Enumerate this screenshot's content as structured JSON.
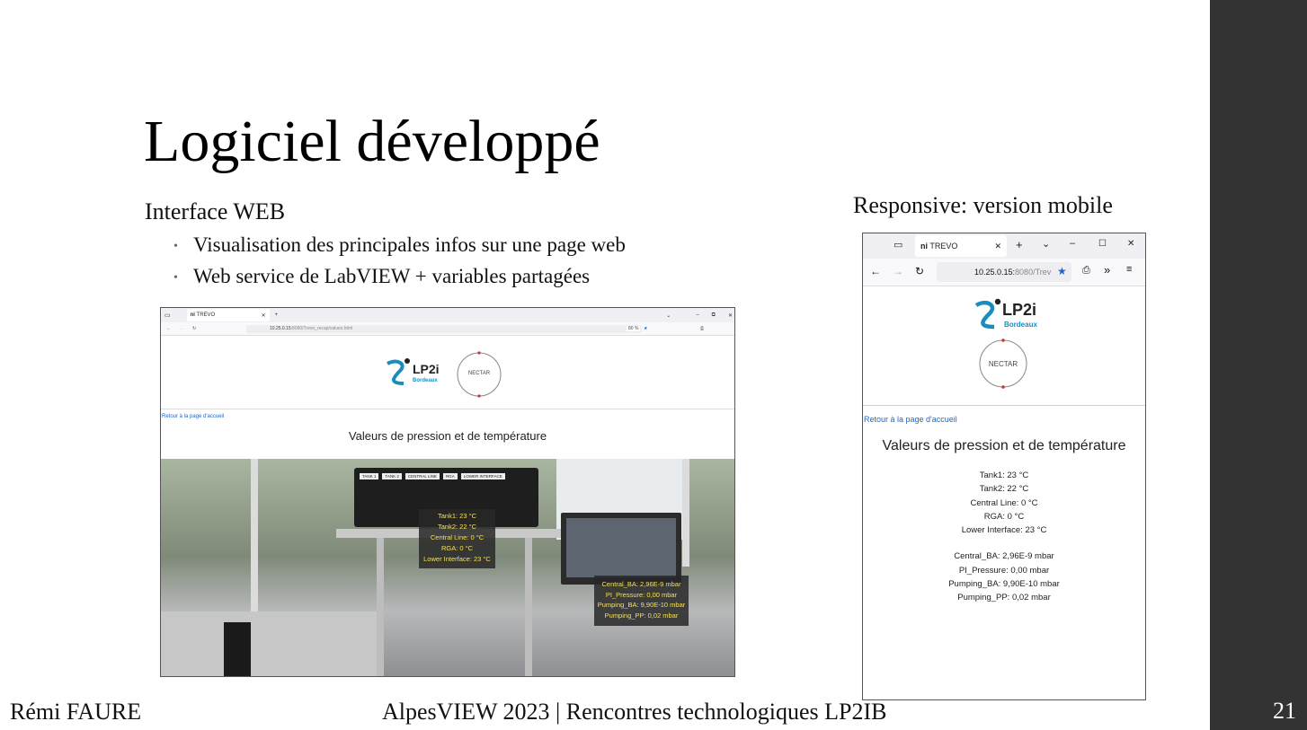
{
  "slide": {
    "title": "Logiciel développé",
    "subtitle": "Interface WEB",
    "bullets": [
      "Visualisation des principales infos sur une page web",
      "Web service de LabVIEW + variables partagées"
    ],
    "mobile_heading": "Responsive: version mobile",
    "footer_author": "Rémi FAURE",
    "footer_event": "AlpesVIEW 2023 | Rencontres technologiques LP2IB",
    "page_number": "21"
  },
  "desktop": {
    "tab_title": "TREVO",
    "url_host": "10.25.0.15:",
    "url_path": "8080/Trevo_recap/values.html",
    "zoom": "80 %",
    "logo_main": "LP2i",
    "logo_sub": "Bordeaux",
    "nectar": "NECTAR",
    "back_link": "Retour à la page d'accueil",
    "heading": "Valeurs de pression et de température",
    "panel_labels": [
      "TANK 1",
      "TANK 2",
      "CENTRAL LINE",
      "RGA",
      "LOWER INTERFACE"
    ],
    "temperatures": [
      "Tank1: 23 °C",
      "Tank2: 22 °C",
      "Central Line: 0 °C",
      "RGA: 0 °C",
      "Lower Interface: 23 °C"
    ],
    "pressures": [
      "Central_BA: 2,96E-9 mbar",
      "PI_Pressure: 0,00 mbar",
      "Pumping_BA: 9,90E-10 mbar",
      "Pumping_PP: 0,02 mbar"
    ]
  },
  "mobile": {
    "tab_title": "TREVO",
    "url_host": "10.25.0.15:",
    "url_path": "8080/Trev",
    "logo_main": "LP2i",
    "logo_sub": "Bordeaux",
    "nectar": "NECTAR",
    "back_link": "Retour à la page d'accueil",
    "heading": "Valeurs de pression et de température",
    "temperatures": [
      "Tank1: 23 °C",
      "Tank2: 22 °C",
      "Central Line: 0 °C",
      "RGA: 0 °C",
      "Lower Interface: 23 °C"
    ],
    "pressures": [
      "Central_BA: 2,96E-9 mbar",
      "PI_Pressure: 0,00 mbar",
      "Pumping_BA: 9,90E-10 mbar",
      "Pumping_PP: 0,02 mbar"
    ]
  },
  "colors": {
    "sidebar": "#333333",
    "link": "#1a67d2",
    "overlay_text": "#f6e05a",
    "logo_blue": "#1a8dbf"
  }
}
